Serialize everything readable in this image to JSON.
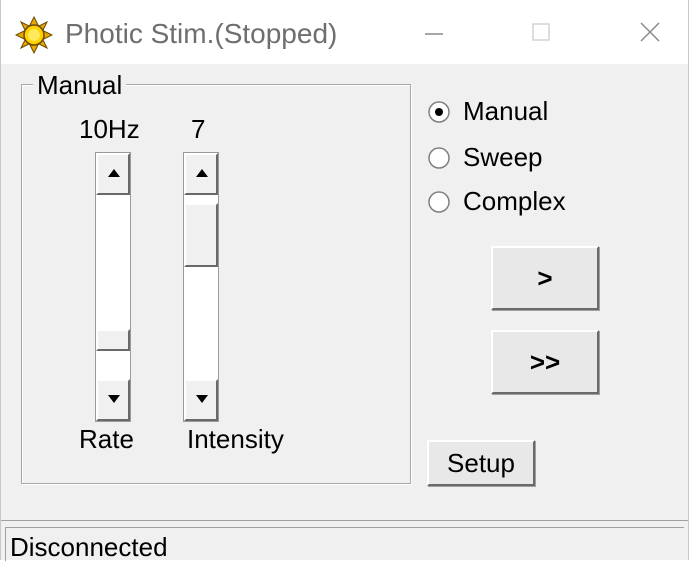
{
  "window": {
    "title": "Photic Stim.(Stopped)",
    "icon": "sun-icon"
  },
  "manual_group": {
    "label": "Manual",
    "rate": {
      "value_label": "10Hz",
      "caption": "Rate",
      "thumb_position": 0.72
    },
    "intensity": {
      "value_label": "7",
      "caption": "Intensity",
      "thumb_position": 0.05
    }
  },
  "mode_options": [
    {
      "label": "Manual",
      "selected": true
    },
    {
      "label": "Sweep",
      "selected": false
    },
    {
      "label": "Complex",
      "selected": false
    }
  ],
  "buttons": {
    "step": ">",
    "fast": ">>",
    "setup": "Setup"
  },
  "status": {
    "text": "Disconnected"
  }
}
